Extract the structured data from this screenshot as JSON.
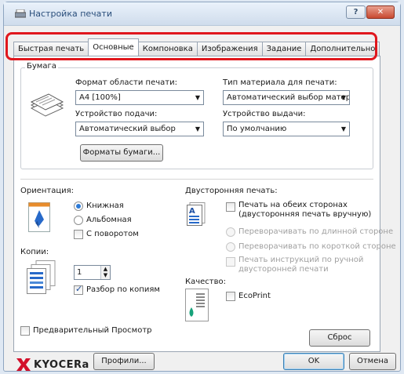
{
  "window": {
    "title": "Настройка печати"
  },
  "title_buttons": {
    "help": "?",
    "close": "✕"
  },
  "tabs": [
    {
      "label": "Быстрая печать"
    },
    {
      "label": "Основные"
    },
    {
      "label": "Компоновка"
    },
    {
      "label": "Изображения"
    },
    {
      "label": "Задание"
    },
    {
      "label": "Дополнительно"
    }
  ],
  "paper": {
    "group_label": "Бумага",
    "print_size_label": "Формат области печати:",
    "print_size_value": "A4 [100%]",
    "media_type_label": "Тип материала для печати:",
    "media_type_value": "Автоматический выбор матер",
    "source_label": "Устройство подачи:",
    "source_value": "Автоматический выбор",
    "output_label": "Устройство выдачи:",
    "output_value": "По умолчанию",
    "paper_sizes_button": "Форматы бумаги..."
  },
  "orientation": {
    "label": "Ориентация:",
    "portrait": "Книжная",
    "landscape": "Альбомная",
    "rotated": "С поворотом"
  },
  "copies": {
    "label": "Копии:",
    "value": "1",
    "collate": "Разбор по копиям"
  },
  "duplex": {
    "label": "Двусторонняя печать:",
    "both_sides": "Печать на обеих сторонах (двусторонняя печать вручную)",
    "both_sides_line1": "Печать на обеих сторонах",
    "both_sides_line2": "(двусторонняя печать вручную)",
    "flip_long": "Переворачивать по длинной стороне",
    "flip_short": "Переворачивать по короткой стороне",
    "instructions_line1": "Печать инструкций по ручной",
    "instructions_line2": "двусторонней печати"
  },
  "quality": {
    "label": "Качество:",
    "ecoprint": "EcoPrint"
  },
  "preview": {
    "label": "Предварительный Просмотр"
  },
  "reset_button": "Сброс",
  "footer": {
    "brand": "KYOCERa",
    "profiles_button": "Профили...",
    "ok_button": "OK",
    "cancel_button": "Отмена"
  },
  "colors": {
    "highlight": "#e0171d",
    "brand": "#d3102b",
    "accent": "#2d7ad6"
  }
}
